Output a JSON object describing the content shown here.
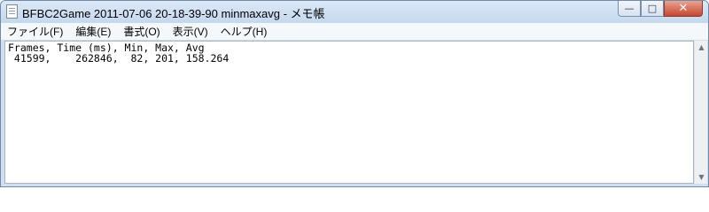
{
  "window": {
    "title": "BFBC2Game 2011-07-06 20-18-39-90 minmaxavg - メモ帳",
    "buttons": {
      "minimize": "—",
      "maximize": "□",
      "close": "✕"
    }
  },
  "menu": [
    {
      "label": "ファイル(F)"
    },
    {
      "label": "編集(E)"
    },
    {
      "label": "書式(O)"
    },
    {
      "label": "表示(V)"
    },
    {
      "label": "ヘルプ(H)"
    }
  ],
  "content": {
    "lines": [
      "Frames, Time (ms), Min, Max, Avg",
      " 41599,    262846,  82, 201, 158.264"
    ]
  },
  "scrollbar": {
    "up": "▲",
    "down": "▼"
  }
}
